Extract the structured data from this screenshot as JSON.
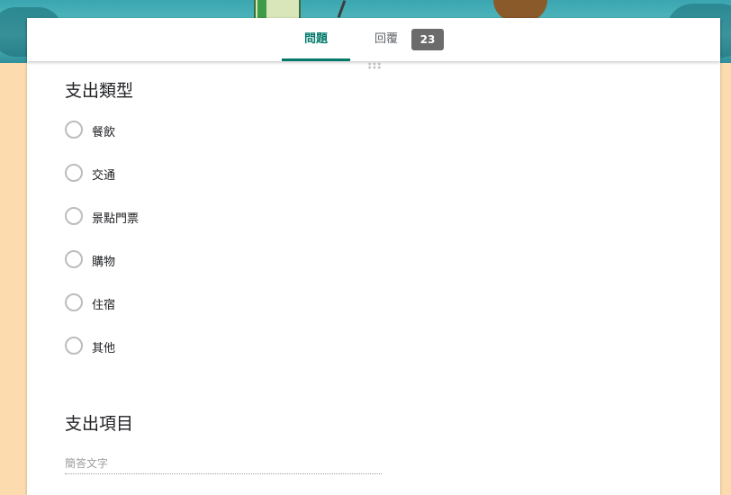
{
  "tabs": {
    "questions_label": "問題",
    "responses_label": "回覆",
    "responses_count": "23"
  },
  "question1": {
    "title": "支出類型",
    "options": [
      "餐飲",
      "交通",
      "景點門票",
      "購物",
      "住宿",
      "其他"
    ]
  },
  "question2": {
    "title": "支出項目",
    "placeholder": "簡答文字"
  },
  "colors": {
    "accent": "#00796b",
    "page_background": "#fcdcae",
    "badge": "#6b6b6b"
  }
}
